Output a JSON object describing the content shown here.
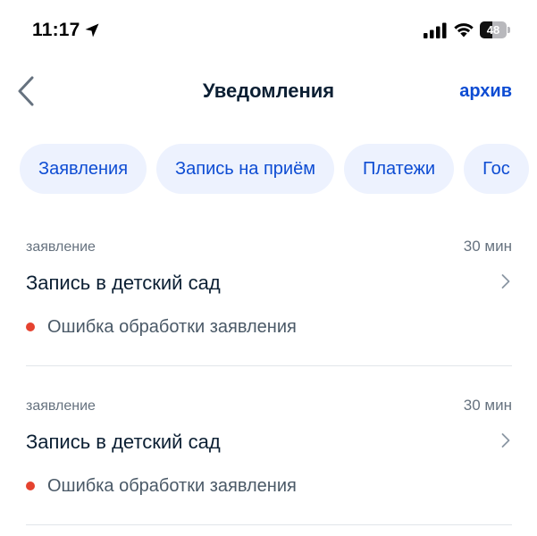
{
  "status_bar": {
    "time": "11:17",
    "location_icon": "location-arrow-icon",
    "signal_icon": "cellular-signal-icon",
    "wifi_icon": "wifi-icon",
    "battery_level": "48",
    "battery_fraction": 0.48
  },
  "header": {
    "back_icon": "chevron-left-icon",
    "title": "Уведомления",
    "archive_label": "архив"
  },
  "filters": [
    {
      "label": "Заявления"
    },
    {
      "label": "Запись на приём"
    },
    {
      "label": "Платежи"
    },
    {
      "label": "Гос"
    }
  ],
  "notifications": [
    {
      "category": "заявление",
      "time": "30 мин",
      "title": "Запись в детский сад",
      "status": "Ошибка обработки заявления"
    },
    {
      "category": "заявление",
      "time": "30 мин",
      "title": "Запись в детский сад",
      "status": "Ошибка обработки заявления"
    }
  ],
  "colors": {
    "accent": "#0d4cd3",
    "chip_background": "#edf2fe",
    "error_dot": "#e5422f",
    "title_text": "#0b1f33",
    "muted_text": "#66727f",
    "divider": "#e1e5ea"
  }
}
